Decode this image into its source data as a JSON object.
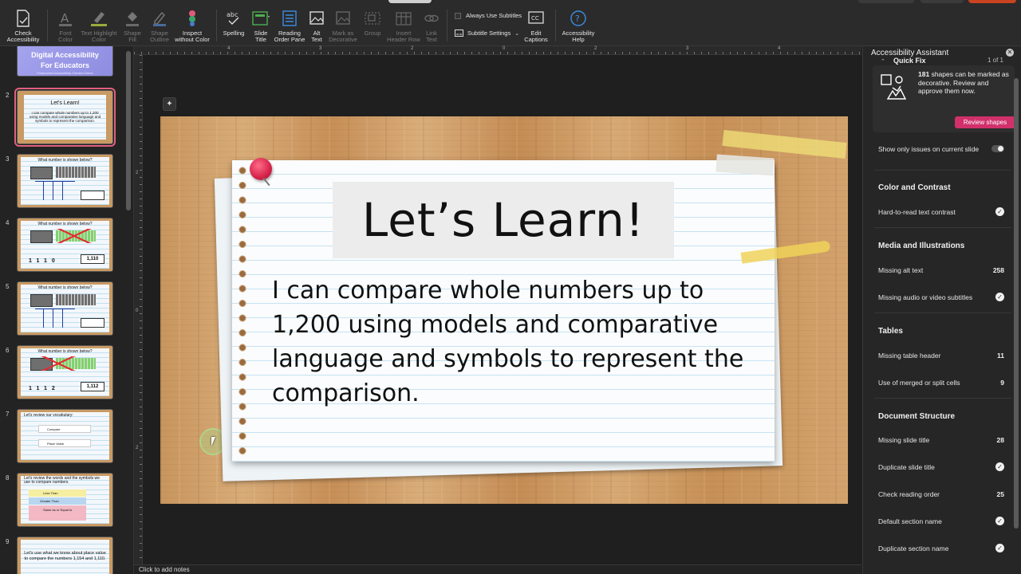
{
  "ribbon": {
    "check_accessibility": "Check\nAccessibility",
    "font_color": "Font\nColor",
    "text_highlight_color": "Text Highlight\nColor",
    "shape_fill": "Shape\nFill",
    "shape_outline": "Shape\nOutline",
    "inspect_without_color": "Inspect\nwithout Color",
    "spelling": "Spelling",
    "slide_title": "Slide\nTitle",
    "reading_order_pane": "Reading\nOrder Pane",
    "alt_text": "Alt\nText",
    "mark_as_decorative": "Mark as\nDecorative",
    "group": "Group",
    "insert_header_row": "Insert\nHeader Row",
    "link_text": "Link\nText",
    "always_use_subtitles": "Always Use Subtitles",
    "subtitle_settings": "Subtitle Settings",
    "edit_captions": "Edit\nCaptions",
    "accessibility_help": "Accessibility\nHelp"
  },
  "thumbnails": {
    "1": {
      "line1": "Digital Accessibility",
      "line2": "For Educators",
      "line3": "Powerpoint Accessibility Checker Demo"
    },
    "2": {
      "num": "2",
      "title": "Let's Learn!",
      "body": "I can compare whole numbers up to 1,200 using models and comparative language and symbols to represent the comparison."
    },
    "3": {
      "num": "3",
      "title": "What number is shown below?"
    },
    "4": {
      "num": "4",
      "title": "What number is shown below?",
      "digits": "1110",
      "value": "1,110"
    },
    "5": {
      "num": "5",
      "title": "What number is shown below?"
    },
    "6": {
      "num": "6",
      "title": "What number is shown below?",
      "digits": "1112",
      "value": "1,112"
    },
    "7": {
      "num": "7",
      "title": "Let's review our vocabulary:",
      "row1": "Compare",
      "row2": "Place Value"
    },
    "8": {
      "num": "8",
      "title": "Let's review the words and the symbols we use to compare numbers.",
      "row1": "Less Than",
      "row2": "Greater Than",
      "row3": "Same as or Equal to"
    },
    "9": {
      "num": "9",
      "title": "Let's use what we know about place value to compare the numbers 1,154 and 1,110."
    }
  },
  "ruler": {
    "h0": "4",
    "h1": "3",
    "h2": "2",
    "h3": "0",
    "h4": "2",
    "h5": "3",
    "h6": "4",
    "v0": "2",
    "v1": "0",
    "v2": "2"
  },
  "slide": {
    "title": "Let’s Learn!",
    "body": "I can compare whole numbers up to 1,200 using models and comparative language and symbols to represent the comparison."
  },
  "notes": {
    "placeholder": "Click to add notes"
  },
  "assistant": {
    "title": "Accessibility Assistant",
    "quick_fix": {
      "title": "Quick Fix",
      "page": "1 of 1",
      "count": "181",
      "description": "shapes can be marked as decorative. Review and approve them now.",
      "button": "Review shapes"
    },
    "show_only_current": "Show only issues on current slide",
    "sections": [
      {
        "title": "Color and Contrast",
        "items": [
          {
            "label": "Hard-to-read text contrast",
            "status": "ok"
          }
        ]
      },
      {
        "title": "Media and Illustrations",
        "items": [
          {
            "label": "Missing alt text",
            "count": "258"
          },
          {
            "label": "Missing audio or video subtitles",
            "status": "ok"
          }
        ]
      },
      {
        "title": "Tables",
        "items": [
          {
            "label": "Missing table header",
            "count": "11"
          },
          {
            "label": "Use of merged or split cells",
            "count": "9"
          }
        ]
      },
      {
        "title": "Document Structure",
        "items": [
          {
            "label": "Missing slide title",
            "count": "28"
          },
          {
            "label": "Duplicate slide title",
            "status": "ok"
          },
          {
            "label": "Check reading order",
            "count": "25"
          },
          {
            "label": "Default section name",
            "status": "ok"
          },
          {
            "label": "Duplicate section name",
            "status": "ok"
          }
        ]
      }
    ]
  },
  "colors": {
    "review_button": "#d1306b",
    "selected_thumbnail": "#e0607e",
    "reading_order_accent": "#3b8de0"
  }
}
